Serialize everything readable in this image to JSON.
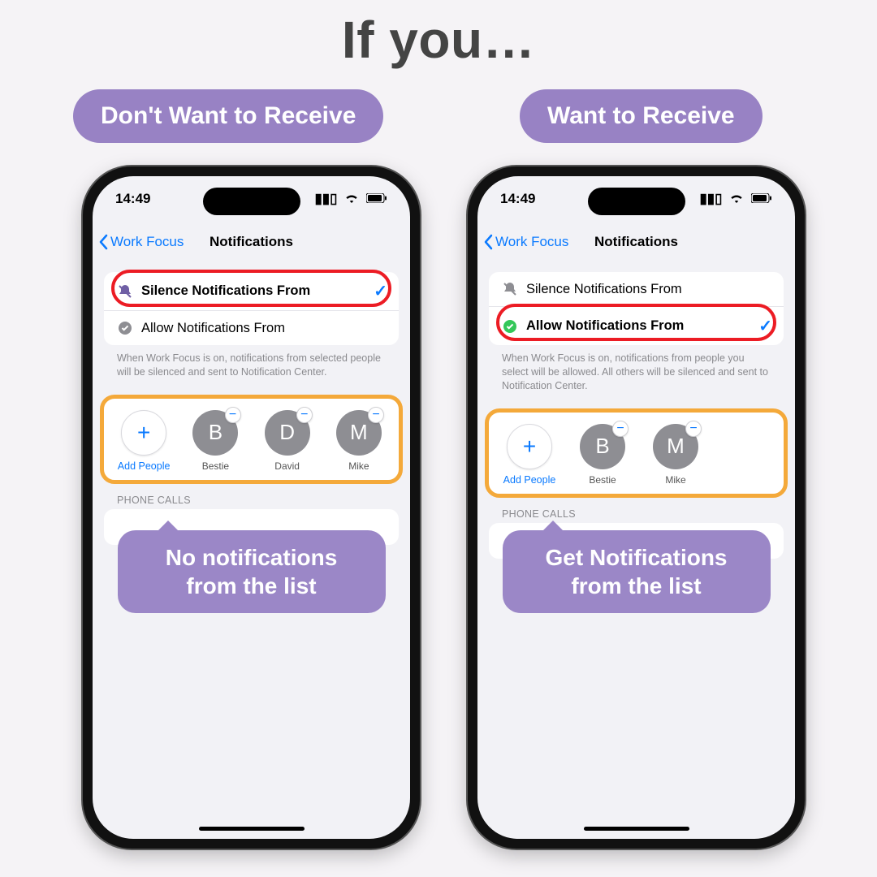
{
  "heading": "If you…",
  "pills": {
    "left": "Don't Want to Receive",
    "right": "Want to Receive"
  },
  "status": {
    "time": "14:49"
  },
  "nav": {
    "back": "Work Focus",
    "title": "Notifications"
  },
  "options": {
    "silence": "Silence Notifications From",
    "allow": "Allow Notifications From"
  },
  "footnote": {
    "silence": "When Work Focus is on, notifications from selected people will be silenced and sent to Notification Center.",
    "allow": "When Work Focus is on, notifications from people you select will be allowed. All others will be silenced and sent to Notification Center."
  },
  "addPeople": "Add People",
  "leftPeople": [
    {
      "initial": "B",
      "name": "Bestie"
    },
    {
      "initial": "D",
      "name": "David"
    },
    {
      "initial": "M",
      "name": "Mike"
    }
  ],
  "rightPeople": [
    {
      "initial": "B",
      "name": "Bestie"
    },
    {
      "initial": "M",
      "name": "Mike"
    }
  ],
  "phoneCallsHeader": "PHONE CALLS",
  "callouts": {
    "left": "No notifications from the list",
    "right": "Get Notifications from the list"
  }
}
